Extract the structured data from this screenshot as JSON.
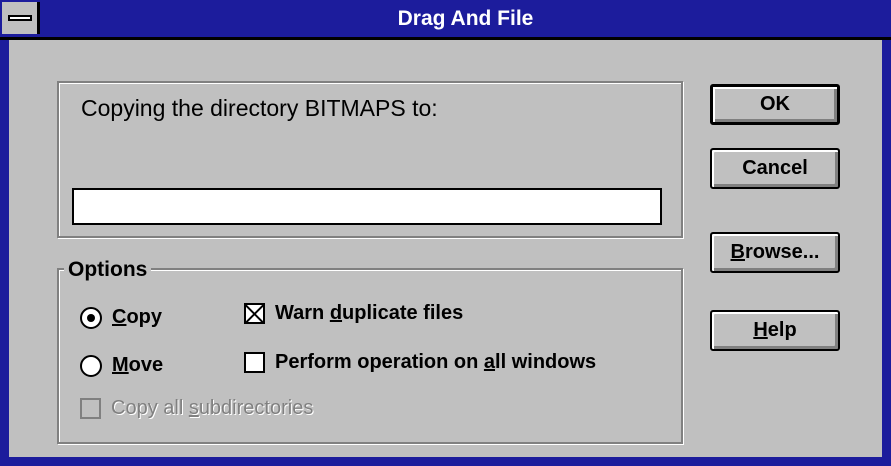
{
  "window": {
    "title": "Drag And File"
  },
  "destination": {
    "label": "Copying the directory BITMAPS to:",
    "value": ""
  },
  "options": {
    "group_label": "Options",
    "operation": [
      {
        "label_pre": "",
        "mnemonic": "C",
        "label_post": "opy",
        "selected": true
      },
      {
        "label_pre": "",
        "mnemonic": "M",
        "label_post": "ove",
        "selected": false
      }
    ],
    "warn_duplicates": {
      "label_pre": "Warn ",
      "mnemonic": "d",
      "label_post": "uplicate files",
      "checked": true
    },
    "all_windows": {
      "label_pre": "Perform operation on ",
      "mnemonic": "a",
      "label_post": "ll windows",
      "checked": false
    },
    "subdirectories": {
      "label_pre": "Copy all ",
      "mnemonic": "s",
      "label_post": "ubdirectories",
      "checked": false,
      "enabled": false
    }
  },
  "buttons": {
    "ok": "OK",
    "cancel": "Cancel",
    "browse": {
      "mnemonic": "B",
      "label_post": "rowse..."
    },
    "help": {
      "mnemonic": "H",
      "label_post": "elp"
    }
  },
  "colors": {
    "titlebar": "#1c1c9c",
    "face": "#c0c0c0",
    "shadow": "#808080"
  }
}
